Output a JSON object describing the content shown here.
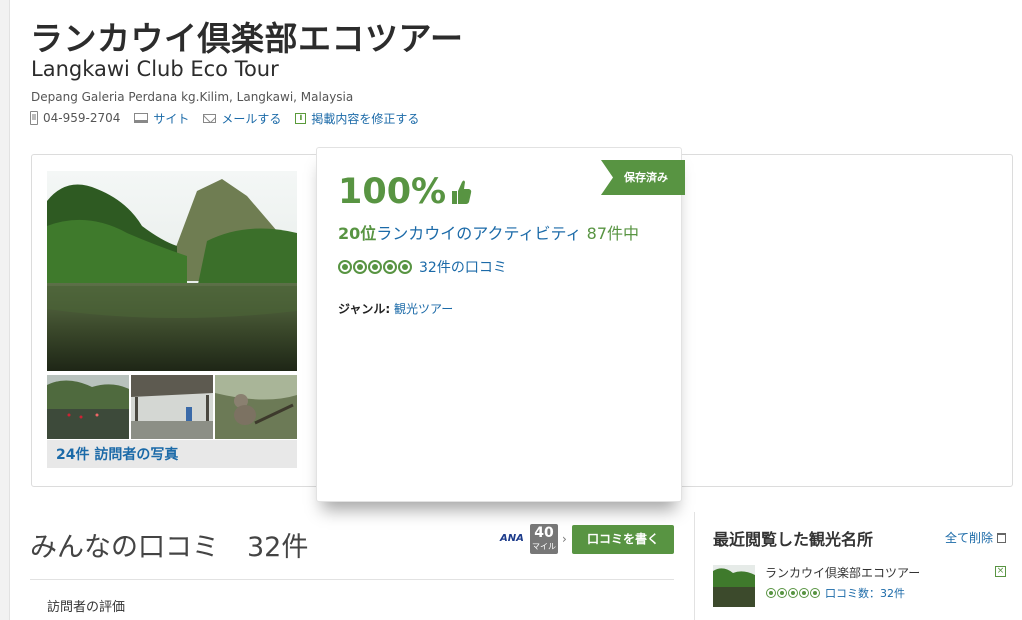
{
  "header": {
    "title_jp": "ランカウイ倶楽部エコツアー",
    "title_en": "Langkawi Club Eco Tour",
    "address": "Depang Galeria Perdana kg.Kilim, Langkawi, Malaysia"
  },
  "contact": {
    "phone": "04-959-2704",
    "site_label": "サイト",
    "email_label": "メールする",
    "edit_label": "掲載内容を修正する"
  },
  "photos": {
    "count_label": "24件 訪問者の写真"
  },
  "rating": {
    "percent": "100%",
    "rank_num": "20位",
    "rank_text": "ランカウイのアクティビティ",
    "rank_total": "87件中",
    "review_count": "32件の口コミ",
    "bubbles": 5,
    "genre_label": "ジャンル:",
    "genre_value": "観光ツアー",
    "saved_label": "保存済み"
  },
  "reviews": {
    "title": "みんなの口コミ",
    "count": "32件",
    "ana_label": "ANA",
    "miles_value": "40",
    "miles_unit": "マイル",
    "write_button": "口コミを書く",
    "visitor_rating_label": "訪問者の評価"
  },
  "recent": {
    "title": "最近閲覧した観光名所",
    "clear_all": "全て削除",
    "items": [
      {
        "name": "ランカウイ倶楽部エコツアー",
        "review_count": "口コミ数：32件",
        "bubbles": 5
      }
    ]
  },
  "colors": {
    "brand_green": "#589442",
    "link_blue": "#1b6aa8"
  }
}
